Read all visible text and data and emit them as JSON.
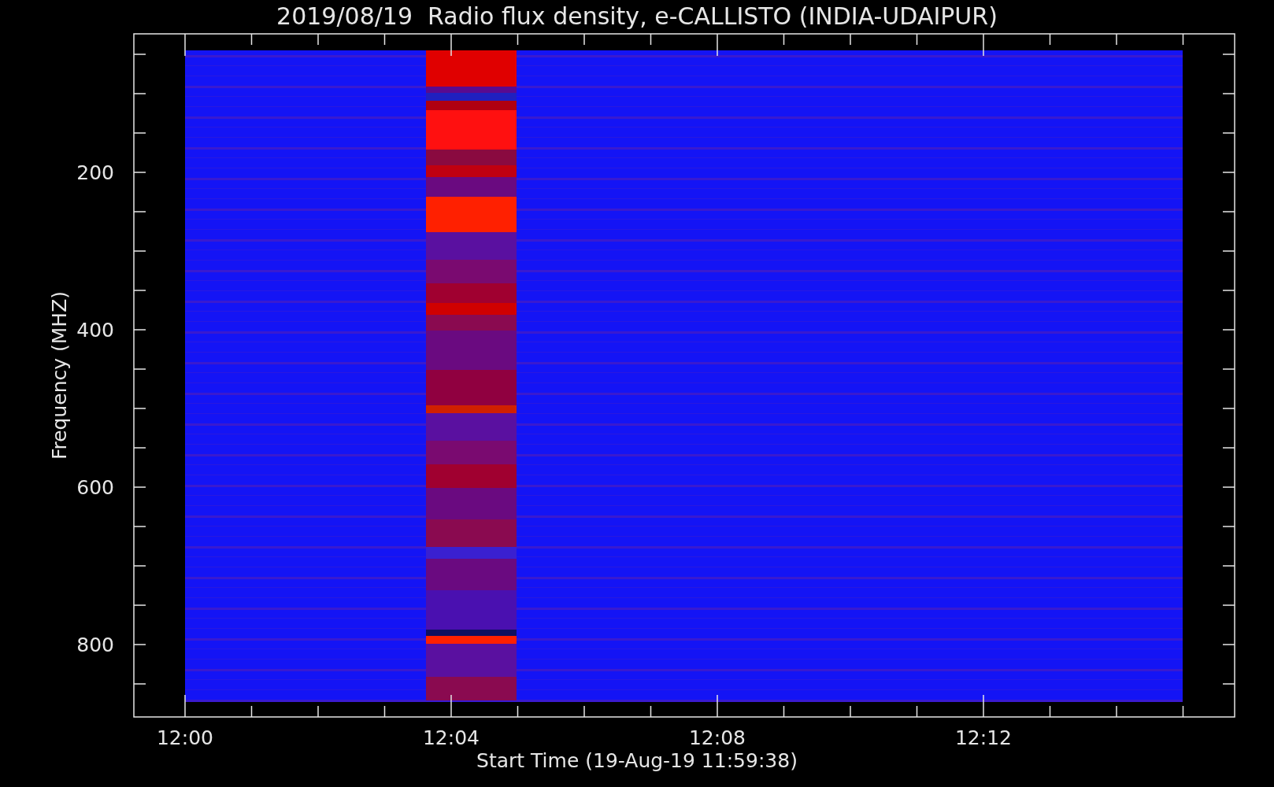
{
  "title": "2019/08/19  Radio flux density, e-CALLISTO (INDIA-UDAIPUR)",
  "y_axis": {
    "label": "Frequency (MHZ)",
    "ticks": [
      "200",
      "400",
      "600",
      "800"
    ]
  },
  "x_axis": {
    "label": "Start Time (19-Aug-19 11:59:38)",
    "ticks": [
      "12:00",
      "12:04",
      "12:08",
      "12:12"
    ]
  }
}
